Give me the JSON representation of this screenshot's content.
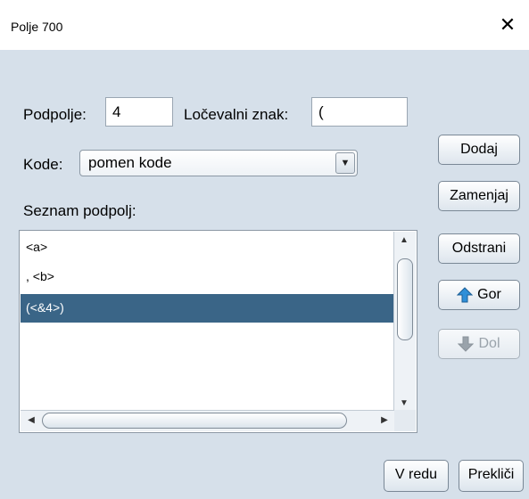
{
  "window": {
    "title": "Polje 700"
  },
  "form": {
    "subfield_label": "Podpolje:",
    "subfield_value": "4",
    "separator_label": "Ločevalni znak:",
    "separator_value": "(",
    "code_label": "Kode:",
    "code_selected": "pomen kode",
    "list_label": "Seznam podpolj:"
  },
  "list": {
    "items": [
      "<a>",
      ", <b>",
      "(<&4>)"
    ],
    "selected_index": 2
  },
  "buttons": {
    "add": "Dodaj",
    "replace": "Zamenjaj",
    "remove": "Odstrani",
    "up": "Gor",
    "down": "Dol",
    "ok": "V redu",
    "cancel": "Prekliči"
  },
  "colors": {
    "background": "#d6e0ea",
    "selection": "#3a6587",
    "up_arrow": "#2f8fd8",
    "disabled_arrow": "#9aa3ab"
  },
  "icons": {
    "close": "close-icon",
    "up": "arrow-up-icon",
    "down": "arrow-down-icon",
    "dropdown": "chevron-down-icon"
  }
}
